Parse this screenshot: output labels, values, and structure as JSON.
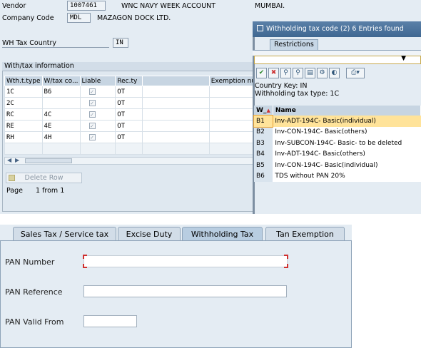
{
  "header": {
    "vendor_label": "Vendor",
    "vendor_value": "1007461",
    "vendor_name": "WNC NAVY WEEK ACCOUNT",
    "vendor_city": "MUMBAI.",
    "company_code_label": "Company Code",
    "company_code_value": "MDL",
    "company_name": "MAZAGON DOCK LTD.",
    "wh_country_label": "WH Tax Country",
    "wh_country_value": "IN"
  },
  "withtax": {
    "section_title": "With/tax information",
    "columns": [
      "Wth.t.type",
      "W/tax co...",
      "Liable",
      "Rec.ty",
      "",
      "Exemption nu"
    ],
    "rows": [
      {
        "type": "1C",
        "code": "B6",
        "rec": "OT"
      },
      {
        "type": "2C",
        "code": "",
        "rec": "OT"
      },
      {
        "type": "RC",
        "code": "4C",
        "rec": "OT"
      },
      {
        "type": "RE",
        "code": "4E",
        "rec": "OT"
      },
      {
        "type": "RH",
        "code": "4H",
        "rec": "OT"
      }
    ],
    "delete_row_label": "Delete Row",
    "page_label": "Page",
    "page_value": "1 from 1"
  },
  "popup": {
    "title": "Withholding tax code (2)   6 Entries found",
    "tab_restrictions": "Restrictions",
    "country_key": "Country Key: IN",
    "wh_tax_type": "Withholding tax type: 1C",
    "col_w": "W_",
    "col_name": "Name",
    "entries": [
      {
        "key": "B1",
        "name": "Inv-ADT-194C- Basic(individual)"
      },
      {
        "key": "B2",
        "name": "Inv-CON-194C- Basic(others)"
      },
      {
        "key": "B3",
        "name": "Inv-SUBCON-194C- Basic- to be deleted"
      },
      {
        "key": "B4",
        "name": "Inv-ADT-194C- Basic(others)"
      },
      {
        "key": "B5",
        "name": "Inv-CON-194C- Basic(individual)"
      },
      {
        "key": "B6",
        "name": "TDS without PAN 20%"
      }
    ],
    "toolbar_icons": [
      "check-icon",
      "cancel-icon",
      "find-icon",
      "find-next-icon",
      "export-icon",
      "settings-icon",
      "print-icon"
    ]
  },
  "bottom": {
    "tabs": [
      "Sales Tax / Service tax",
      "Excise Duty",
      "Withholding Tax",
      "Tan Exemption"
    ],
    "pan_number_label": "PAN Number",
    "pan_reference_label": "PAN Reference",
    "pan_valid_from_label": "PAN Valid From"
  },
  "colors": {
    "title_bar": "#3f6791",
    "selected_row": "#ffe39a",
    "panel_bg": "#e4ecf3"
  }
}
